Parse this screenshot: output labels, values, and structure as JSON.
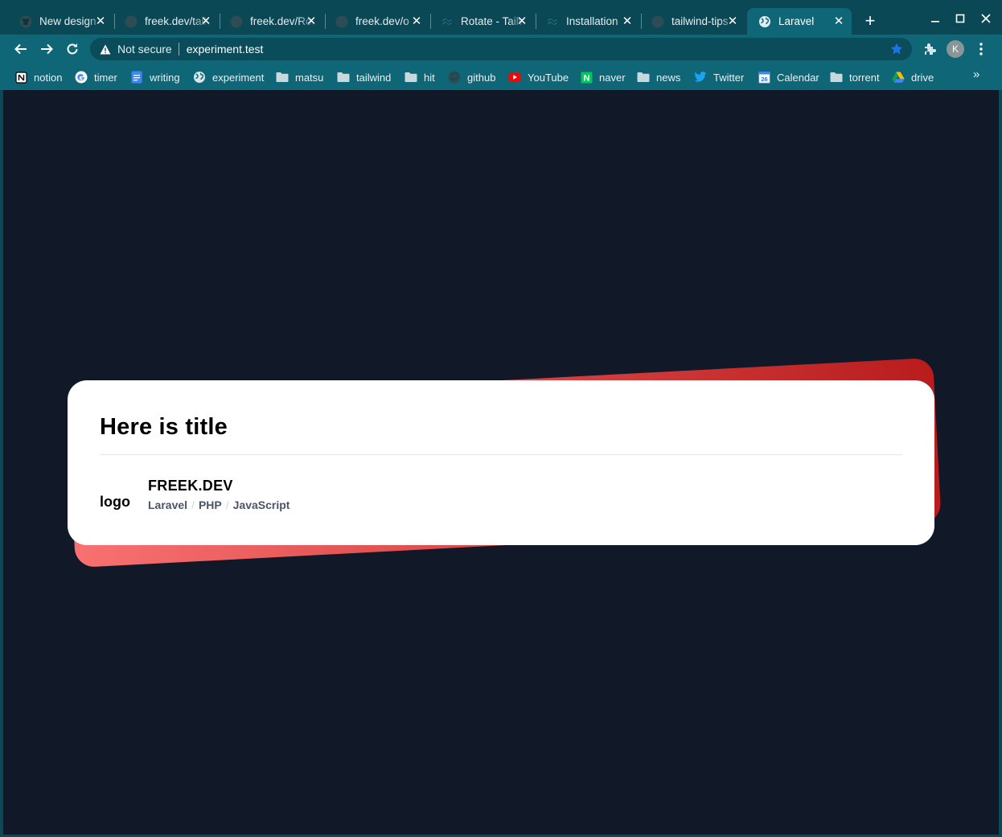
{
  "tabs": [
    {
      "title": "New design",
      "icon": "github-icon"
    },
    {
      "title": "freek.dev/tailwind",
      "icon": "github-icon"
    },
    {
      "title": "freek.dev/Rotate",
      "icon": "github-icon"
    },
    {
      "title": "freek.dev/o",
      "icon": "github-icon"
    },
    {
      "title": "Rotate - Tailwind",
      "icon": "tailwind-icon"
    },
    {
      "title": "Installation",
      "icon": "tailwind-icon"
    },
    {
      "title": "tailwind-tips",
      "icon": "github-icon"
    },
    {
      "title": "Laravel",
      "icon": "globe-icon",
      "active": true
    }
  ],
  "toolbar": {
    "security_label": "Not secure",
    "url": "experiment.test",
    "profile_initial": "K"
  },
  "bookmarks": [
    {
      "label": "notion",
      "icon": "notion-icon"
    },
    {
      "label": "timer",
      "icon": "google-icon"
    },
    {
      "label": "writing",
      "icon": "docs-icon"
    },
    {
      "label": "experiment",
      "icon": "globe-icon"
    },
    {
      "label": "matsu",
      "icon": "folder-icon"
    },
    {
      "label": "tailwind",
      "icon": "folder-icon"
    },
    {
      "label": "hit",
      "icon": "folder-icon"
    },
    {
      "label": "github",
      "icon": "github-icon"
    },
    {
      "label": "YouTube",
      "icon": "youtube-icon"
    },
    {
      "label": "naver",
      "icon": "naver-icon"
    },
    {
      "label": "news",
      "icon": "folder-icon"
    },
    {
      "label": "Twitter",
      "icon": "twitter-icon"
    },
    {
      "label": "Calendar",
      "icon": "calendar-icon"
    },
    {
      "label": "torrent",
      "icon": "folder-icon"
    },
    {
      "label": "drive",
      "icon": "drive-icon"
    }
  ],
  "calendar_day": "26",
  "naver_letter": "N",
  "card": {
    "title": "Here is title",
    "logo": "logo",
    "brand": "FREEK.DEV",
    "tags": [
      "Laravel",
      "PHP",
      "JavaScript"
    ],
    "tag_separator": "/"
  },
  "colors": {
    "frame": "#0b4957",
    "toolbar": "#0e6677",
    "page_bg": "#111827",
    "gradient_from": "#f87171",
    "gradient_to": "#b91c1c",
    "card_bg": "#ffffff"
  }
}
